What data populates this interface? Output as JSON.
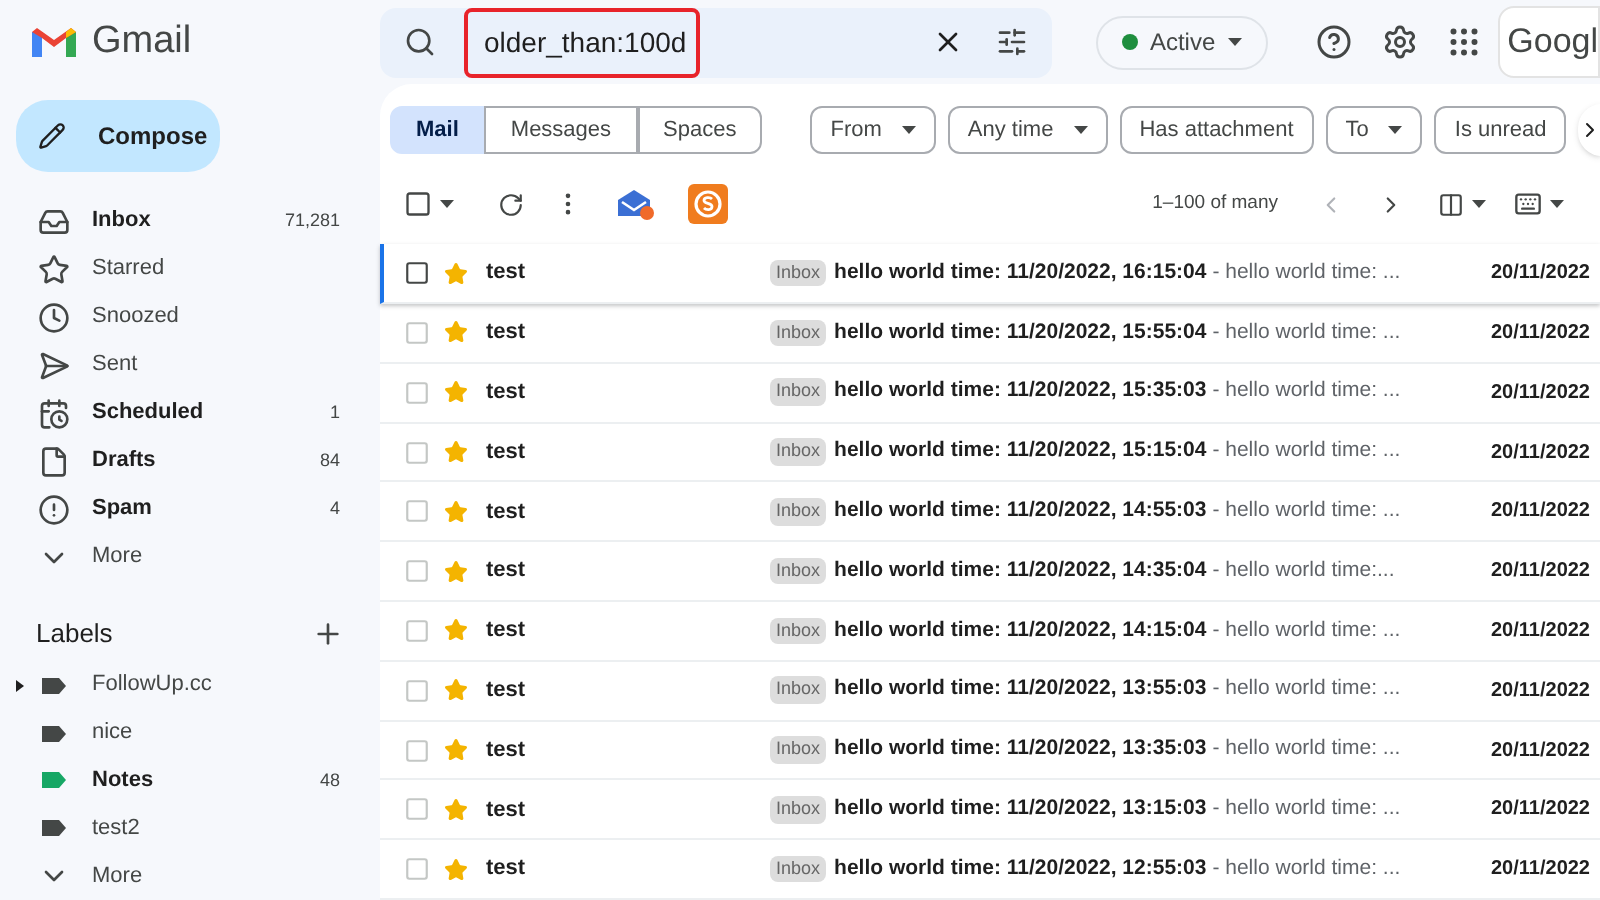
{
  "app": {
    "name": "Gmail"
  },
  "search": {
    "query": "older_than:100d"
  },
  "status": {
    "label": "Active",
    "color": "#1e8e3e"
  },
  "account": {
    "label": "Googl"
  },
  "compose": {
    "label": "Compose"
  },
  "nav": [
    {
      "kind": "inbox",
      "label": "Inbox",
      "count": "71,281",
      "bold": true
    },
    {
      "kind": "starred",
      "label": "Starred",
      "bold": false
    },
    {
      "kind": "snoozed",
      "label": "Snoozed",
      "bold": false
    },
    {
      "kind": "sent",
      "label": "Sent",
      "bold": false
    },
    {
      "kind": "scheduled",
      "label": "Scheduled",
      "count": "1",
      "bold": true
    },
    {
      "kind": "drafts",
      "label": "Drafts",
      "count": "84",
      "bold": true
    },
    {
      "kind": "spam",
      "label": "Spam",
      "count": "4",
      "bold": true
    },
    {
      "kind": "more",
      "label": "More",
      "bold": false
    }
  ],
  "labels": {
    "title": "Labels",
    "items": [
      {
        "label": "FollowUp.cc",
        "color": "#444746",
        "bold": false,
        "collapsible": true
      },
      {
        "label": "nice",
        "color": "#444746",
        "bold": false,
        "collapsible": false
      },
      {
        "label": "Notes",
        "color": "#16a765",
        "bold": true,
        "count": "48",
        "collapsible": false
      },
      {
        "label": "test2",
        "color": "#444746",
        "bold": false,
        "collapsible": false
      }
    ],
    "more": "More"
  },
  "scope_tabs": [
    {
      "label": "Mail",
      "selected": true
    },
    {
      "label": "Messages",
      "selected": false
    },
    {
      "label": "Spaces",
      "selected": false
    }
  ],
  "filters": [
    {
      "label": "From",
      "dropdown": true
    },
    {
      "label": "Any time",
      "dropdown": true
    },
    {
      "label": "Has attachment",
      "dropdown": false
    },
    {
      "label": "To",
      "dropdown": true
    },
    {
      "label": "Is unread",
      "dropdown": false
    }
  ],
  "select_all": {
    "checked": false
  },
  "pagination": "1–100 of many",
  "rows": [
    {
      "sender": "test",
      "tag": "Inbox",
      "subject": "hello world time: 11/20/2022, 16:15:04",
      "snippet": "- hello world time: ...",
      "date": "20/11/2022",
      "checked": false,
      "starred": true,
      "focused": true
    },
    {
      "sender": "test",
      "tag": "Inbox",
      "subject": "hello world time: 11/20/2022, 15:55:04",
      "snippet": "- hello world time: ...",
      "date": "20/11/2022",
      "checked": false,
      "starred": true,
      "focused": false
    },
    {
      "sender": "test",
      "tag": "Inbox",
      "subject": "hello world time: 11/20/2022, 15:35:03",
      "snippet": "- hello world time: ...",
      "date": "20/11/2022",
      "checked": false,
      "starred": true,
      "focused": false
    },
    {
      "sender": "test",
      "tag": "Inbox",
      "subject": "hello world time: 11/20/2022, 15:15:04",
      "snippet": "- hello world time: ...",
      "date": "20/11/2022",
      "checked": false,
      "starred": true,
      "focused": false
    },
    {
      "sender": "test",
      "tag": "Inbox",
      "subject": "hello world time: 11/20/2022, 14:55:03",
      "snippet": "- hello world time: ...",
      "date": "20/11/2022",
      "checked": false,
      "starred": true,
      "focused": false
    },
    {
      "sender": "test",
      "tag": "Inbox",
      "subject": "hello world time: 11/20/2022, 14:35:04",
      "snippet": "- hello world time:...",
      "date": "20/11/2022",
      "checked": false,
      "starred": true,
      "focused": false
    },
    {
      "sender": "test",
      "tag": "Inbox",
      "subject": "hello world time: 11/20/2022, 14:15:04",
      "snippet": "- hello world time: ...",
      "date": "20/11/2022",
      "checked": false,
      "starred": true,
      "focused": false
    },
    {
      "sender": "test",
      "tag": "Inbox",
      "subject": "hello world time: 11/20/2022, 13:55:03",
      "snippet": "- hello world time: ...",
      "date": "20/11/2022",
      "checked": false,
      "starred": true,
      "focused": false
    },
    {
      "sender": "test",
      "tag": "Inbox",
      "subject": "hello world time: 11/20/2022, 13:35:03",
      "snippet": "- hello world time: ...",
      "date": "20/11/2022",
      "checked": false,
      "starred": true,
      "focused": false
    },
    {
      "sender": "test",
      "tag": "Inbox",
      "subject": "hello world time: 11/20/2022, 13:15:03",
      "snippet": "- hello world time: ...",
      "date": "20/11/2022",
      "checked": false,
      "starred": true,
      "focused": false
    },
    {
      "sender": "test",
      "tag": "Inbox",
      "subject": "hello world time: 11/20/2022, 12:55:03",
      "snippet": "- hello world time: ...",
      "date": "20/11/2022",
      "checked": false,
      "starred": true,
      "focused": false
    }
  ]
}
